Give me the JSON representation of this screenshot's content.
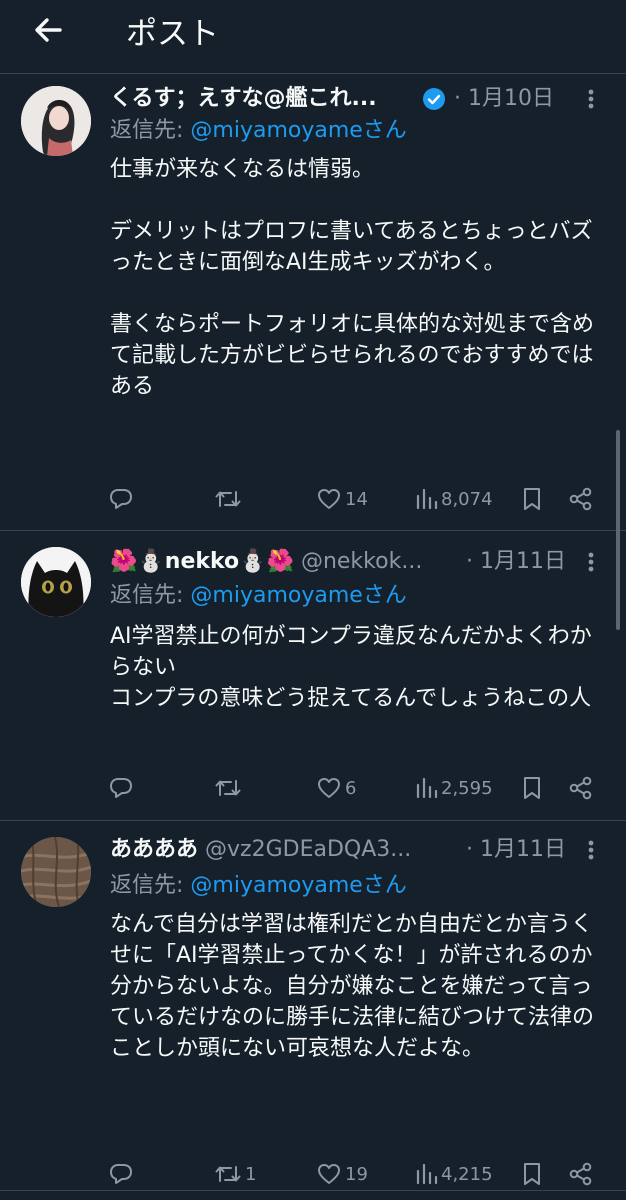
{
  "header": {
    "title": "ポスト"
  },
  "posts": [
    {
      "name": "くるす；えすな@艦これ...",
      "handle": "",
      "verified": true,
      "date": "1月10日",
      "reply_prefix": "返信先: ",
      "reply_mention": "@miyamoyameさん",
      "text": "仕事が来なくなるは情弱。\n\nデメリットはプロフに書いてあるとちょっとバズったときに面倒なAI生成キッズがわく。\n\n書くならポートフォリオに具体的な対処まで含めて記載した方がビビらせられるのでおすすめではある",
      "retweets": "",
      "likes": "14",
      "views": "8,074"
    },
    {
      "name": "🌺⛄nekko⛄🌺",
      "handle": "@nekkok...",
      "verified": false,
      "date": "1月11日",
      "reply_prefix": "返信先: ",
      "reply_mention": "@miyamoyameさん",
      "text": "AI学習禁止の何がコンプラ違反なんだかよくわからない\nコンプラの意味どう捉えてるんでしょうねこの人",
      "retweets": "",
      "likes": "6",
      "views": "2,595"
    },
    {
      "name": "ああああ",
      "handle": "@vz2GDEaDQA3...",
      "verified": false,
      "date": "1月11日",
      "reply_prefix": "返信先: ",
      "reply_mention": "@miyamoyameさん",
      "text": "なんで自分は学習は権利だとか自由だとか言うくせに「AI学習禁止ってかくな！」が許されるのか分からないよな。自分が嫌なことを嫌だって言っているだけなのに勝手に法律に結びつけて法律のことしか頭にない可哀想な人だよな。",
      "retweets": "1",
      "likes": "19",
      "views": "4,215"
    }
  ],
  "colors": {
    "background": "#15202b",
    "text": "#f7f9f9",
    "secondary": "#8b98a5",
    "accent": "#1d9bf0",
    "divider": "#38444d"
  }
}
